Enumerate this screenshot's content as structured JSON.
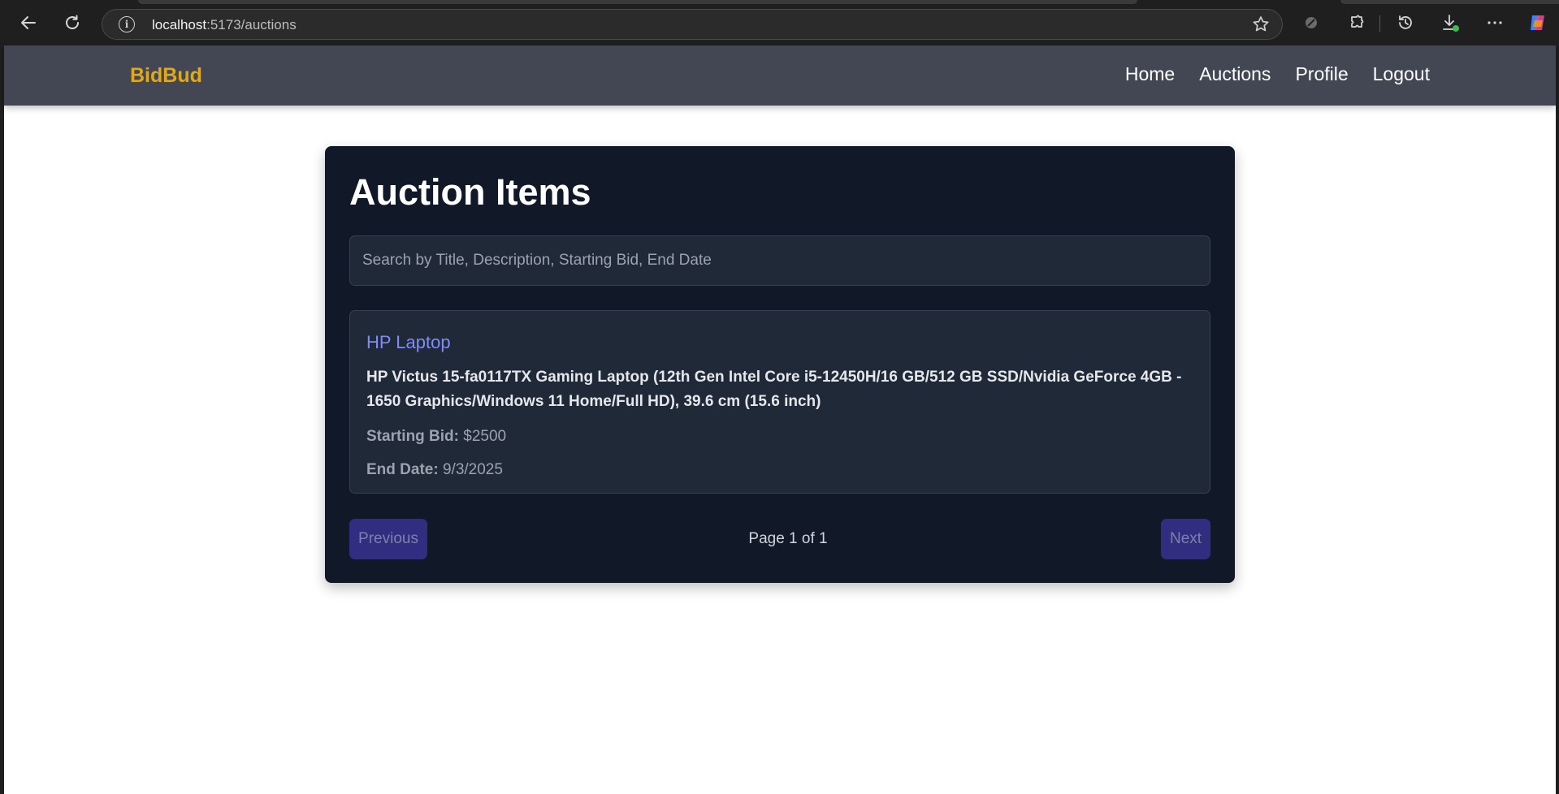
{
  "browser": {
    "url_host": "localhost",
    "url_path": ":5173/auctions"
  },
  "navbar": {
    "brand": "BidBud",
    "links": [
      "Home",
      "Auctions",
      "Profile",
      "Logout"
    ]
  },
  "main": {
    "title": "Auction Items",
    "search_placeholder": "Search by Title, Description, Starting Bid, End Date",
    "items": [
      {
        "title": "HP Laptop",
        "description": "HP Victus 15-fa0117TX Gaming Laptop (12th Gen Intel Core i5-12450H/16 GB/512 GB SSD/Nvidia GeForce 4GB - 1650 Graphics/Windows 11 Home/Full HD), 39.6 cm (15.6 inch)",
        "starting_bid_label": "Starting Bid:",
        "starting_bid": "$2500",
        "end_date_label": "End Date:",
        "end_date": "9/3/2025"
      }
    ],
    "pagination": {
      "prev_label": "Previous",
      "page_info": "Page 1 of 1",
      "next_label": "Next"
    }
  },
  "colors": {
    "brand": "#e0a915",
    "navbar_bg": "#424753",
    "card_bg": "#111827",
    "item_bg": "#1f2937",
    "item_title": "#818cf8",
    "pager_btn": "#312e81"
  }
}
